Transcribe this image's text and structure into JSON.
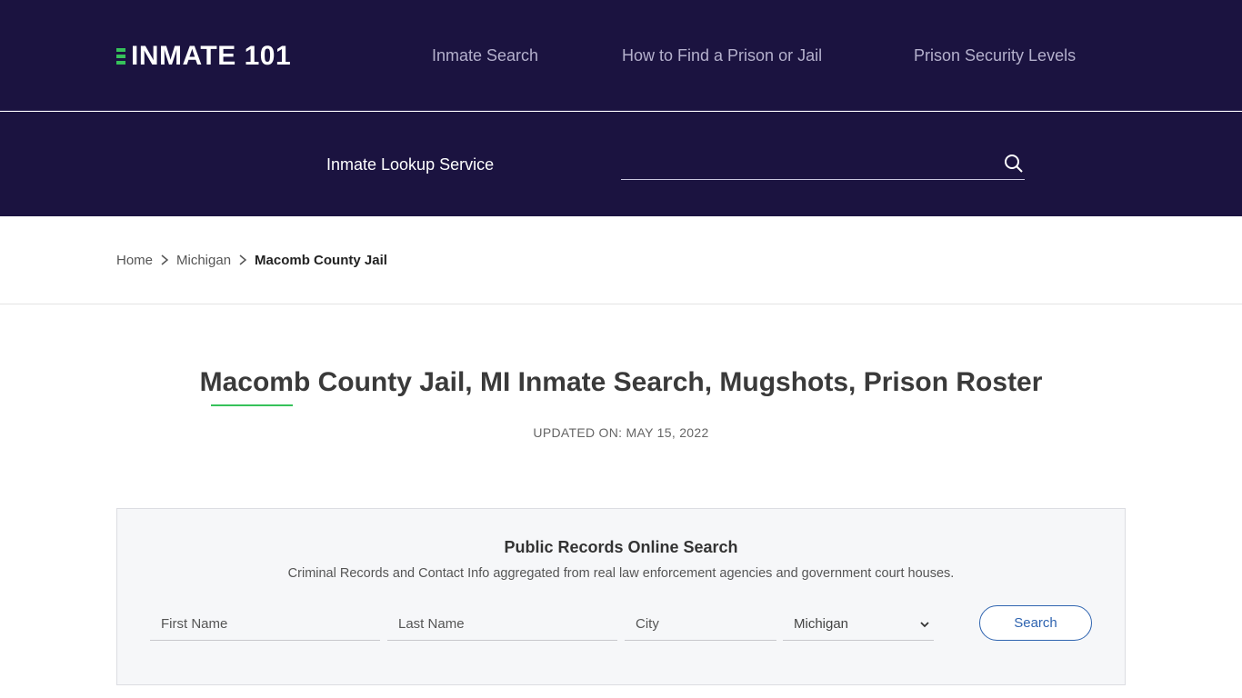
{
  "header": {
    "logo_text": "INMATE 101",
    "nav": [
      {
        "label": "Inmate Search"
      },
      {
        "label": "How to Find a Prison or Jail"
      },
      {
        "label": "Prison Security Levels"
      }
    ]
  },
  "lookup": {
    "label": "Inmate Lookup Service",
    "search_value": "",
    "search_icon": "search-icon"
  },
  "breadcrumb": {
    "items": [
      "Home",
      "Michigan"
    ],
    "current": "Macomb County Jail"
  },
  "page": {
    "title": "Macomb County Jail, MI Inmate Search, Mugshots, Prison Roster",
    "updated": "UPDATED ON: MAY 15, 2022"
  },
  "records": {
    "title": "Public Records Online Search",
    "subtitle": "Criminal Records and Contact Info aggregated from real law enforcement agencies and government court houses.",
    "first_name_placeholder": "First Name",
    "last_name_placeholder": "Last Name",
    "city_placeholder": "City",
    "state_value": "Michigan",
    "search_label": "Search"
  },
  "colors": {
    "header_bg": "#1b1340",
    "accent_green": "#36c25a",
    "button_blue": "#2f64b0"
  }
}
